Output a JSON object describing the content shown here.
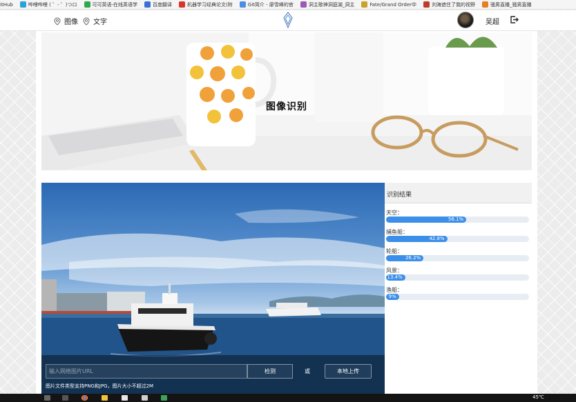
{
  "bookmarks": [
    {
      "label": "itHub",
      "icon_color": "#333333"
    },
    {
      "label": "哔哩哔哩 ( ゜- ゜)つロ",
      "icon_color": "#2ba3d9"
    },
    {
      "label": "可可英语-在线英语学",
      "icon_color": "#2fa84f"
    },
    {
      "label": "百度翻译",
      "icon_color": "#3a6fd8"
    },
    {
      "label": "机器学习经典论文(附",
      "icon_color": "#d9342b"
    },
    {
      "label": "Git简介 - 廖雪峰的官",
      "icon_color": "#4b8fe2"
    },
    {
      "label": "洞主歌神洞庭湖_洞主",
      "icon_color": "#9b59b6"
    },
    {
      "label": "Fate/Grand Order中",
      "icon_color": "#c9a227"
    },
    {
      "label": "刘海遮住了我的视野",
      "icon_color": "#c0392b"
    },
    {
      "label": "骚男直播_骚男直播",
      "icon_color": "#e67e22"
    }
  ],
  "nav": {
    "image_label": "图像",
    "text_label": "文字",
    "username": "吴超"
  },
  "banner": {
    "title": "图像识别"
  },
  "upload": {
    "url_placeholder": "输入网络图片URL",
    "detect_label": "检测",
    "or_label": "或",
    "upload_label": "本地上传",
    "hint": "图片文件类型支持PNG和JPG，图片大小不超过2M"
  },
  "results": {
    "header": "识别结果",
    "items": [
      {
        "label": "天空：",
        "value": "56.1%",
        "fraction": 0.561
      },
      {
        "label": "捕鱼船：",
        "value": "42.8%",
        "fraction": 0.428
      },
      {
        "label": "轮船：",
        "value": "26.2%",
        "fraction": 0.262
      },
      {
        "label": "风景：",
        "value": "13.4%",
        "fraction": 0.134
      },
      {
        "label": "渔船：",
        "value": "9%",
        "fraction": 0.09
      }
    ]
  },
  "taskbar": {
    "temperature": "45℃"
  },
  "colors": {
    "accent": "#3b8fe8",
    "track": "#e8ecf3"
  }
}
